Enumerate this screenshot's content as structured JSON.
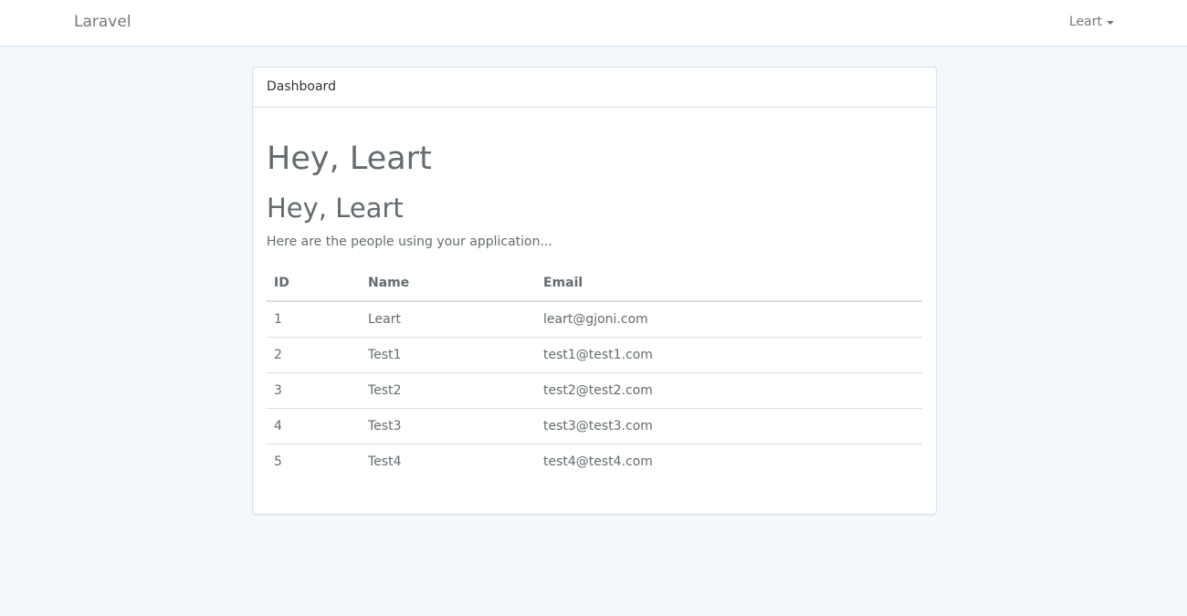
{
  "navbar": {
    "brand": "Laravel",
    "user": "Leart"
  },
  "panel": {
    "heading": "Dashboard",
    "greeting_h1": "Hey, Leart",
    "greeting_h2": "Hey, Leart",
    "lead": "Here are the people using your application..."
  },
  "table": {
    "headers": [
      "ID",
      "Name",
      "Email"
    ],
    "rows": [
      {
        "id": "1",
        "name": "Leart",
        "email": "leart@gjoni.com"
      },
      {
        "id": "2",
        "name": "Test1",
        "email": "test1@test1.com"
      },
      {
        "id": "3",
        "name": "Test2",
        "email": "test2@test2.com"
      },
      {
        "id": "4",
        "name": "Test3",
        "email": "test3@test3.com"
      },
      {
        "id": "5",
        "name": "Test4",
        "email": "test4@test4.com"
      }
    ]
  },
  "colors": {
    "background": "#f5f8fa",
    "border": "#d3e0e9",
    "text": "#636b6f"
  }
}
